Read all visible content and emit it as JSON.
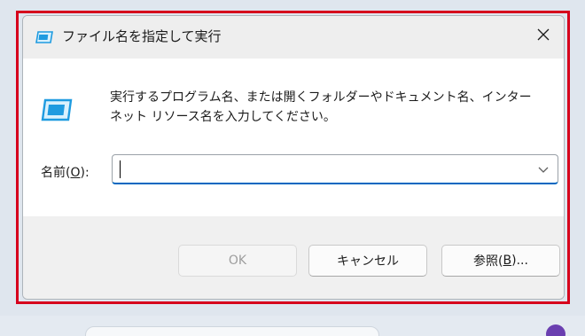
{
  "dialog": {
    "title": "ファイル名を指定して実行",
    "description_line1": "実行するプログラム名、または開くフォルダーやドキュメント名、インター",
    "description_line2": "ネット リソース名を入力してください。",
    "name_label_prefix": "名前(",
    "name_label_accel": "O",
    "name_label_suffix": "):",
    "name_value": "",
    "buttons": {
      "ok": "OK",
      "cancel": "キャンセル",
      "browse_prefix": "参照(",
      "browse_accel": "B",
      "browse_suffix": ")..."
    }
  },
  "icons": {
    "title": "run-app-icon",
    "main": "run-app-icon",
    "close": "close-icon",
    "dropdown": "chevron-down-icon"
  },
  "colors": {
    "highlight_border": "#d6001c",
    "input_focus": "#0067c0",
    "icon_accent": "#1e9be0"
  }
}
